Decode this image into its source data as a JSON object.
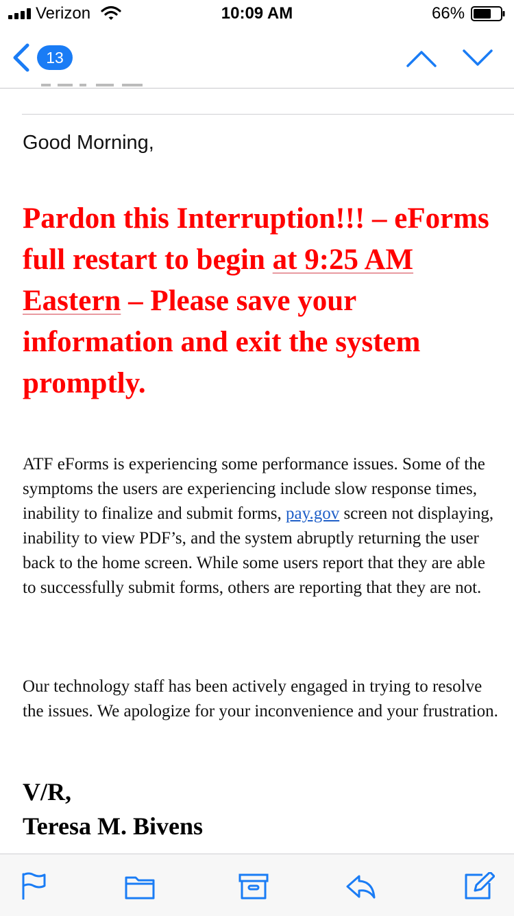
{
  "status_bar": {
    "carrier": "Verizon",
    "time": "10:09 AM",
    "battery_percent": "66%",
    "battery_level": 0.66
  },
  "nav": {
    "back_count": "13"
  },
  "email": {
    "greeting": "Good Morning,",
    "alert": {
      "part1": "Pardon this Interruption!!! – eForms full restart to begin ",
      "part2": "at 9:25 AM Eastern",
      "part3": " – Please save your information and exit the system promptly."
    },
    "paragraph1": {
      "before_link": "ATF eForms is experiencing some performance issues. Some of the symptoms the users are experiencing include slow response times, inability to finalize and submit forms, ",
      "link": "pay.gov",
      "after_link": " screen not displaying, inability to view PDF’s, and the system abruptly returning the user back to the home screen. While some users report that they are able to successfully submit forms, others are reporting that they are not."
    },
    "paragraph2": "Our technology staff has been actively engaged in trying to resolve the issues.  We apologize for your inconvenience and your frustration.",
    "signoff": "V/R,",
    "signature": "Teresa M. Bivens"
  },
  "colors": {
    "accent": "#1a7cf5",
    "alert_red": "#ff0000",
    "link_blue": "#1f5fc8"
  },
  "toolbar_icons": [
    "flag-icon",
    "folder-icon",
    "archive-icon",
    "reply-icon",
    "compose-icon"
  ]
}
